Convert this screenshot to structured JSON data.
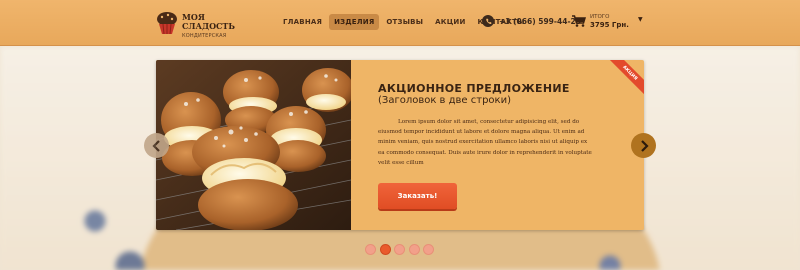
{
  "header": {
    "logo": {
      "title": "Моя сладость",
      "subtitle": "кондитерская"
    },
    "nav": {
      "items": [
        {
          "label": "Главная",
          "active": false
        },
        {
          "label": "Изделия",
          "active": true
        },
        {
          "label": "Отзывы",
          "active": false
        },
        {
          "label": "Акции",
          "active": false
        },
        {
          "label": "Контакты",
          "active": false
        }
      ]
    },
    "phone": "+3 (066) 599-44-25",
    "cart": {
      "label": "Итого",
      "total": "3795 Грн."
    }
  },
  "slider": {
    "ribbon": "Акция",
    "title": "Акционное предложение",
    "subtitle": "(Заголовок в две строки)",
    "text": "Lorem ipsum dolor sit amet, consectetur adipisicing elit, sed do eiusmod tempor incididunt ut labore et dolore magna aliqua. Ut enim ad minim veniam, quis nostrud exercitation ullamco laboris nisi ut aliquip ex ea commodo consequat. Duis aute irure dolor in reprehenderit in voluptate velit esse cillum",
    "button": "Заказать!",
    "slide_count": 5,
    "active_slide": 2
  },
  "colors": {
    "header_bg": "#eeb067",
    "slide_bg": "#efb566",
    "accent": "#e8552c",
    "arrow_active": "#b0731f",
    "text_dark": "#3a2413"
  },
  "icons": {
    "prev": "chevron-left-icon",
    "next": "chevron-right-icon",
    "phone": "phone-icon",
    "cart": "cart-icon",
    "logo": "cupcake-icon"
  }
}
